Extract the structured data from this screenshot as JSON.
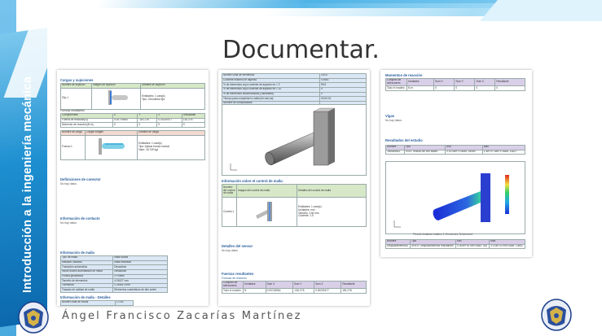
{
  "slide": {
    "title": "Documentar.",
    "side_title": "Introducción a la ingeniería mecánica",
    "author": "Ángel Francisco Zacarías Martínez"
  },
  "page1": {
    "cargas_title": "Cargas y sujeciones",
    "sujecion_headers": [
      "Nombre de sujeción",
      "Imagen de sujeción",
      "Detalles de sujeción"
    ],
    "sujecion_name": "Fijo-1",
    "sujecion_details": [
      "Entidades: 1 cara(s)",
      "Tipo: Geometría fija"
    ],
    "fuerzas_title": "Fuerzas resultantes",
    "fuerzas_headers": [
      "Componentes",
      "X",
      "Y",
      "Z",
      "Resultante"
    ],
    "fuerzas_rows": [
      [
        "Fuerza de reacción(N)",
        "0.00716964",
        "-181.276",
        "0.00230477",
        "181.276"
      ],
      [
        "Momento de reacción(N.m)",
        "0",
        "0",
        "0",
        "0"
      ]
    ],
    "carga_headers": [
      "Nombre de carga",
      "Cargar imagen",
      "Detalles de carga"
    ],
    "carga_name": "Fuerza-1",
    "carga_details": [
      "Entidades: 1 cara(s)",
      "Tipo: Aplicar fuerza normal",
      "Valor: 18.749 kgf"
    ],
    "conectores_title": "Definiciones de conector",
    "conectores_note": "No hay datos",
    "contacto_title": "Información de contacto",
    "contacto_note": "No hay datos",
    "malla_title": "Información de malla",
    "malla_rows": [
      [
        "Tipo de malla",
        "Malla sólida"
      ],
      [
        "Mallador utilizado",
        "Malla estándar"
      ],
      [
        "Transición automática",
        "Desactivar"
      ],
      [
        "Incluir bucles automáticos de malla",
        "Desactivar"
      ],
      [
        "Puntos jacobianos",
        "4 Puntos"
      ],
      [
        "Tamaño de elementos",
        "4.91627 mm"
      ],
      [
        "Tolerancia",
        "0.245813 mm"
      ],
      [
        "Trazado de calidad de malla",
        "Elementos cuadráticos de alto orden"
      ]
    ],
    "malla_det_title": "Información de malla - Detalles",
    "malla_det_row": [
      "Número total de nodos",
      "17139"
    ]
  },
  "page2": {
    "rows": [
      [
        "Número total de elementos",
        "11047"
      ],
      [
        "Cociente máximo de aspecto",
        "4.5461"
      ],
      [
        "% de elementos cuyo cociente de aspecto es < 3",
        "99.6"
      ],
      [
        "% de elementos cuyo cociente de aspecto es > 10",
        "0"
      ],
      [
        "% de elementos distorsionados (Jacobiana)",
        "0"
      ],
      [
        "Tiempo para completar la malla (hh;mm;ss):",
        "00:00:01"
      ],
      [
        "Nombre de computadora:",
        ""
      ]
    ],
    "control_title": "Información sobre el control de malla:",
    "control_headers": [
      "Nombre del control de malla",
      "Imagen del control de malla",
      "Detalles del control de malla"
    ],
    "control_name": "Control-1",
    "control_details": [
      "Entidades: 1 cara(s)",
      "Unidades: mm",
      "Tamaño: 2.46 mm",
      "Cociente: 1.5"
    ],
    "sensor_title": "Detalles del sensor",
    "sensor_note": "No hay datos",
    "fuerzas_title": "Fuerzas resultantes",
    "reaccion_title": "Fuerzas de reacción",
    "reaccion_headers": [
      "Conjunto de selecciones",
      "Unidades",
      "Sum X",
      "Sum Y",
      "Sum Z",
      "Resultante"
    ],
    "reaccion_row": [
      "Todo el modelo",
      "N",
      "0.00716964",
      "-181.276",
      "0.00230477",
      "181.276"
    ]
  },
  "page3": {
    "momentos_title": "Momentos de reacción",
    "momentos_headers": [
      "Conjunto de selecciones",
      "Unidades",
      "Sum X",
      "Sum Y",
      "Sum Z",
      "Resultante"
    ],
    "momentos_row": [
      "Todo el modelo",
      "N.m",
      "0",
      "0",
      "0",
      "0"
    ],
    "vigas_title": "Vigas",
    "vigas_note": "No hay datos",
    "resultados_title": "Resultados del estudio",
    "res_headers": [
      "Nombre",
      "Tipo",
      "Mín.",
      "Máx."
    ],
    "res_row": [
      "Tensiones1",
      "VON: Tensión de von Mises",
      "0.00 N/m^2 Nodo: 16989",
      "1.4e+07 N/m^2 Nodo: 13827"
    ],
    "plot_caption": "Pieza1-Análisis estático 1-Tensiones-Tensiones1",
    "disp_headers": [
      "Nombre",
      "Tipo",
      "Mín.",
      "Máx."
    ],
    "disp_row": [
      "Desplazamientos1",
      "URES: Desplazamientos resultantes",
      "0.000e+00 mm Nodo: 185",
      "3.078e-02 mm Nodo: 13651"
    ]
  },
  "colors": {
    "band_blue": "#1d8fd0",
    "light_blue": "#8fd3f4",
    "section_blue": "#2b5f9e",
    "green_header": "#d7e8c8",
    "lavender_header": "#d9cfe8"
  },
  "icons": {
    "seal_left": "unam-seal-icon",
    "seal_right": "unam-seal-icon"
  }
}
